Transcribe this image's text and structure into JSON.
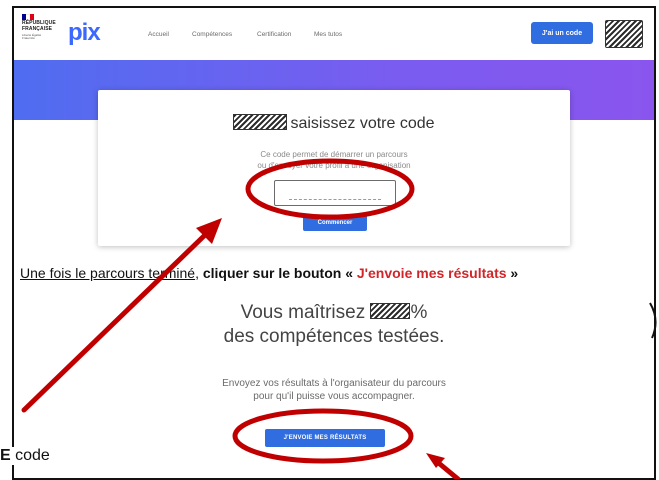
{
  "navbar": {
    "logo_flag_colors": [
      "#000091",
      "#ffffff",
      "#e1000f"
    ],
    "logo_text_line1": "RÉPUBLIQUE",
    "logo_text_line2": "FRANÇAISE",
    "logo_motto": "Liberté Égalité Fraternité",
    "brand": "pix",
    "links": [
      "Accueil",
      "Compétences",
      "Certification",
      "Mes tutos"
    ],
    "code_button": "J'ai un code"
  },
  "card": {
    "title": "saisissez votre code",
    "desc_line1": "Ce code permet de démarrer un parcours",
    "desc_line2": "ou d'envoyer votre profil à une organisation",
    "start_button": "Commencer"
  },
  "instruction": {
    "part1": "Une fois le parcours terminé",
    "part2": ", ",
    "part3": "cliquer sur le bouton « ",
    "part4": "J'envoie mes résultats",
    "part5": " »"
  },
  "result": {
    "line1_before": "Vous maîtrisez ",
    "line1_after": "%",
    "line2": "des compétences testées.",
    "msg_line1": "Envoyez vos résultats à l'organisateur du parcours",
    "msg_line2": "pour qu'il puisse vous accompagner.",
    "send_button": "J'ENVOIE MES RÉSULTATS"
  },
  "bottom_note": {
    "bold": "E",
    "text": " code"
  },
  "colors": {
    "accent_blue": "#2f6de0",
    "annotation_red": "#c00000",
    "banner_start": "#4f6df0",
    "banner_end": "#8a55ee",
    "instruction_red": "#d0262a"
  }
}
